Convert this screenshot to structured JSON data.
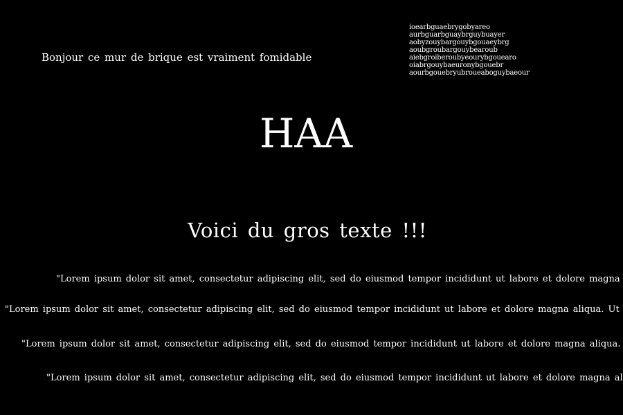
{
  "greeting": "Bonjour ce mur de brique est vraiment fomidable",
  "gibberish_lines": [
    "ioearbguaebrygobyareo",
    "aurbguarbguaybrguybuayer",
    "aobyzouybargouybgouaeybrg",
    "aoubgroubargouybearoub",
    "aiebgroiberoubyeourybgouearo",
    "oiabrgouybaeuronybgouebr",
    "aourbgouebryubroueaboguybaeour"
  ],
  "title": "HAA",
  "subtitle": "Voici du gros texte !!!",
  "paragraphs": [
    "\"Lorem ipsum dolor sit amet, consectetur adipiscing elit, sed do eiusmod tempor incididunt ut labore et dolore magna aliqua. Ut enim ad minim veniam, quis nostrud exercitation ullamco laboris nisi ut aliquip ex ea commodo consequat.\"",
    "\"Lorem ipsum dolor sit amet, consectetur adipiscing elit, sed do eiusmod tempor incididunt ut labore et dolore magna aliqua. Ut enim ad minim veniam, quis nostrud exercitation ullamco laboris nisi ut aliquip ex ea commodo consequat.\"",
    "\"Lorem ipsum dolor sit amet, consectetur adipiscing elit, sed do eiusmod tempor incididunt ut labore et dolore magna aliqua. Ut enim ad minim veniam, quis nostrud exercitation ullamco laboris nisi ut aliquip ex ea commodo consequat.\"",
    "\"Lorem ipsum dolor sit amet, consectetur adipiscing elit, sed do eiusmod tempor incididunt ut labore et dolore magna aliqua. Ut enim ad minim veniam, quis nostrud exercitation ullamco laboris nisi ut aliquip ex ea commodo consequat.\""
  ]
}
